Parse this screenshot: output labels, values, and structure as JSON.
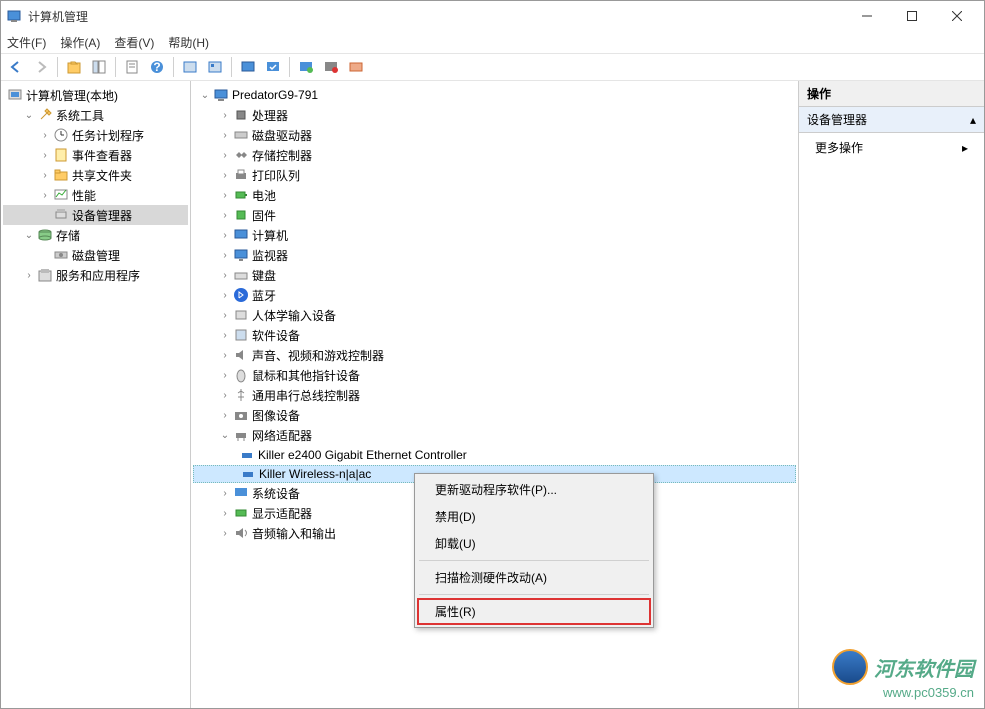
{
  "window": {
    "title": "计算机管理"
  },
  "menu": {
    "file": "文件(F)",
    "action": "操作(A)",
    "view": "查看(V)",
    "help": "帮助(H)"
  },
  "leftTree": {
    "root": "计算机管理(本地)",
    "sysTools": "系统工具",
    "taskSched": "任务计划程序",
    "eventViewer": "事件查看器",
    "sharedFolders": "共享文件夹",
    "perf": "性能",
    "devMgr": "设备管理器",
    "storage": "存储",
    "diskMgmt": "磁盘管理",
    "services": "服务和应用程序"
  },
  "center": {
    "computer": "PredatorG9-791",
    "cpu": "处理器",
    "diskdrive": "磁盘驱动器",
    "storagectrl": "存储控制器",
    "printq": "打印队列",
    "battery": "电池",
    "firmware": "固件",
    "computers": "计算机",
    "monitor": "监视器",
    "keyboard": "键盘",
    "bluetooth": "蓝牙",
    "hid": "人体学输入设备",
    "software": "软件设备",
    "sound": "声音、视频和游戏控制器",
    "mouse": "鼠标和其他指针设备",
    "usb": "通用串行总线控制器",
    "imaging": "图像设备",
    "network": "网络适配器",
    "net1": "Killer e2400 Gigabit Ethernet Controller",
    "net2": "Killer Wireless-n|a|ac",
    "sysdev": "系统设备",
    "display": "显示适配器",
    "audio": "音频输入和输出"
  },
  "contextMenu": {
    "updateDriver": "更新驱动程序软件(P)...",
    "disable": "禁用(D)",
    "uninstall": "卸载(U)",
    "scan": "扫描检测硬件改动(A)",
    "properties": "属性(R)"
  },
  "rightPane": {
    "header": "操作",
    "section": "设备管理器",
    "moreActions": "更多操作"
  },
  "watermark": {
    "name": "河东软件园",
    "url": "www.pc0359.cn"
  }
}
